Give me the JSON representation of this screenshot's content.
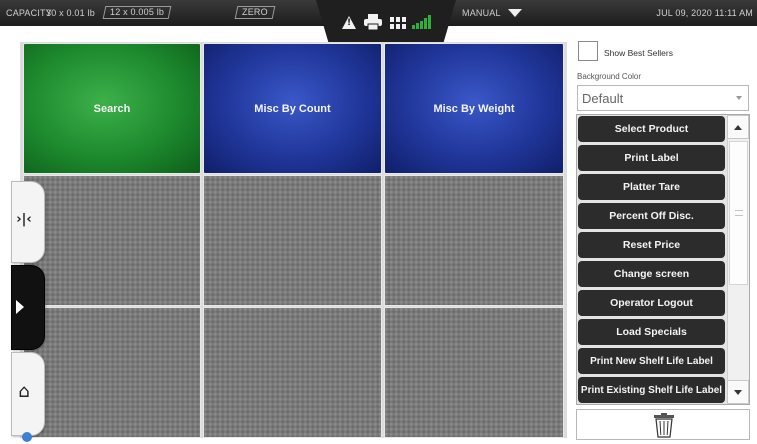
{
  "status_bar": {
    "capacity_label": "CAPACITY",
    "capacity_value": "30 x 0.01 lb",
    "increment": "12 x 0.005 lb",
    "zero_label": "ZERO",
    "mode": "MANUAL",
    "datetime": "JUL 09, 2020 11:11 AM",
    "icons": [
      "warning-icon",
      "printer-icon",
      "grid-icon",
      "signal-icon",
      "chevron-down-icon"
    ]
  },
  "grid": {
    "keys": [
      {
        "label": "Search",
        "color": "#1d8a2e"
      },
      {
        "label": "Misc By Count",
        "color": "#20369a"
      },
      {
        "label": "Misc By Weight",
        "color": "#20369a"
      }
    ],
    "empty_slots": 6
  },
  "side_handles": [
    {
      "icon": "scale-icon"
    },
    {
      "icon": "arrow-right-icon"
    },
    {
      "icon": "home-icon"
    }
  ],
  "right_panel": {
    "show_best_sellers_label": "Show Best Sellers",
    "show_best_sellers_checked": false,
    "background_color_label": "Background Color",
    "background_color_value": "Default",
    "buttons": [
      "Select Product",
      "Print Label",
      "Platter Tare",
      "Percent Off Disc.",
      "Reset Price",
      "Change screen",
      "Operator Logout",
      "Load Specials",
      "Print New Shelf Life Label",
      "Print Existing Shelf Life Label"
    ],
    "trash_icon": "trash-icon"
  }
}
